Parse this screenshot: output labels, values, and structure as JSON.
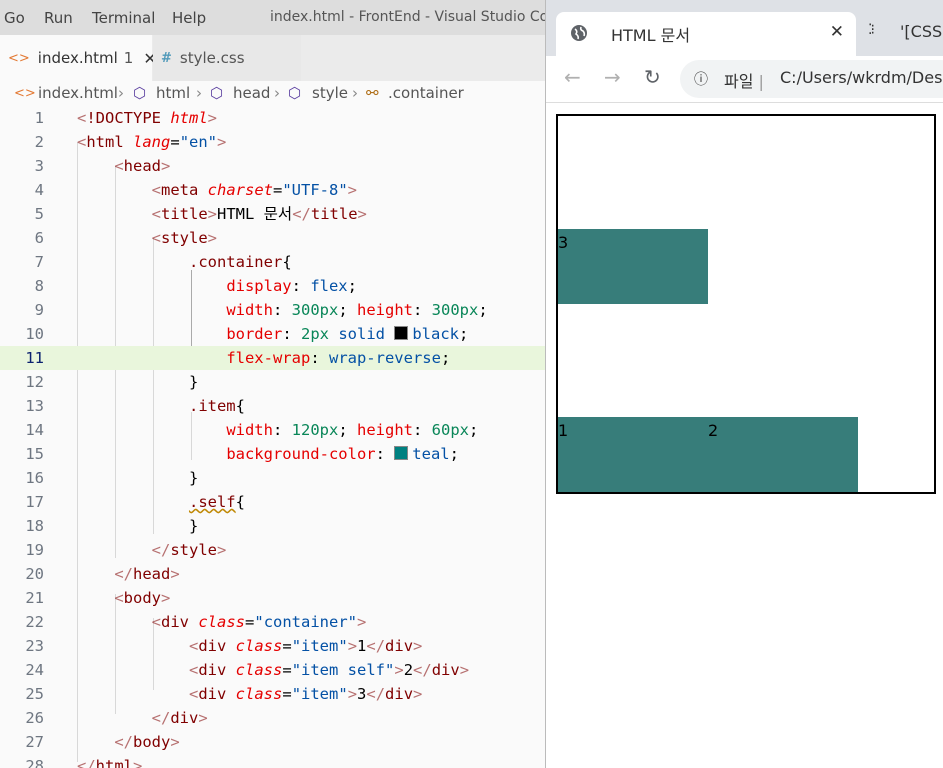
{
  "vscode": {
    "menu": [
      "Go",
      "Run",
      "Terminal",
      "Help"
    ],
    "window_title": "index.html - FrontEnd - Visual Studio Code",
    "tabs": [
      {
        "icon": "html-file-icon",
        "label": "index.html",
        "badge": "1",
        "active": true
      },
      {
        "icon": "css-file-icon",
        "label": "style.css",
        "active": false
      }
    ],
    "breadcrumb": [
      "index.html",
      "html",
      "head",
      "style",
      ".container"
    ],
    "active_line": 11
  },
  "browser": {
    "active_tab_title": "HTML 문서",
    "other_tab_title": "'[CSS]",
    "omnibox": {
      "scheme": "파일",
      "url": "C:/Users/wkrdm/Desk"
    },
    "items": [
      "1",
      "2",
      "3"
    ],
    "colors": {
      "item": "#377d7a",
      "border": "#000000"
    }
  }
}
